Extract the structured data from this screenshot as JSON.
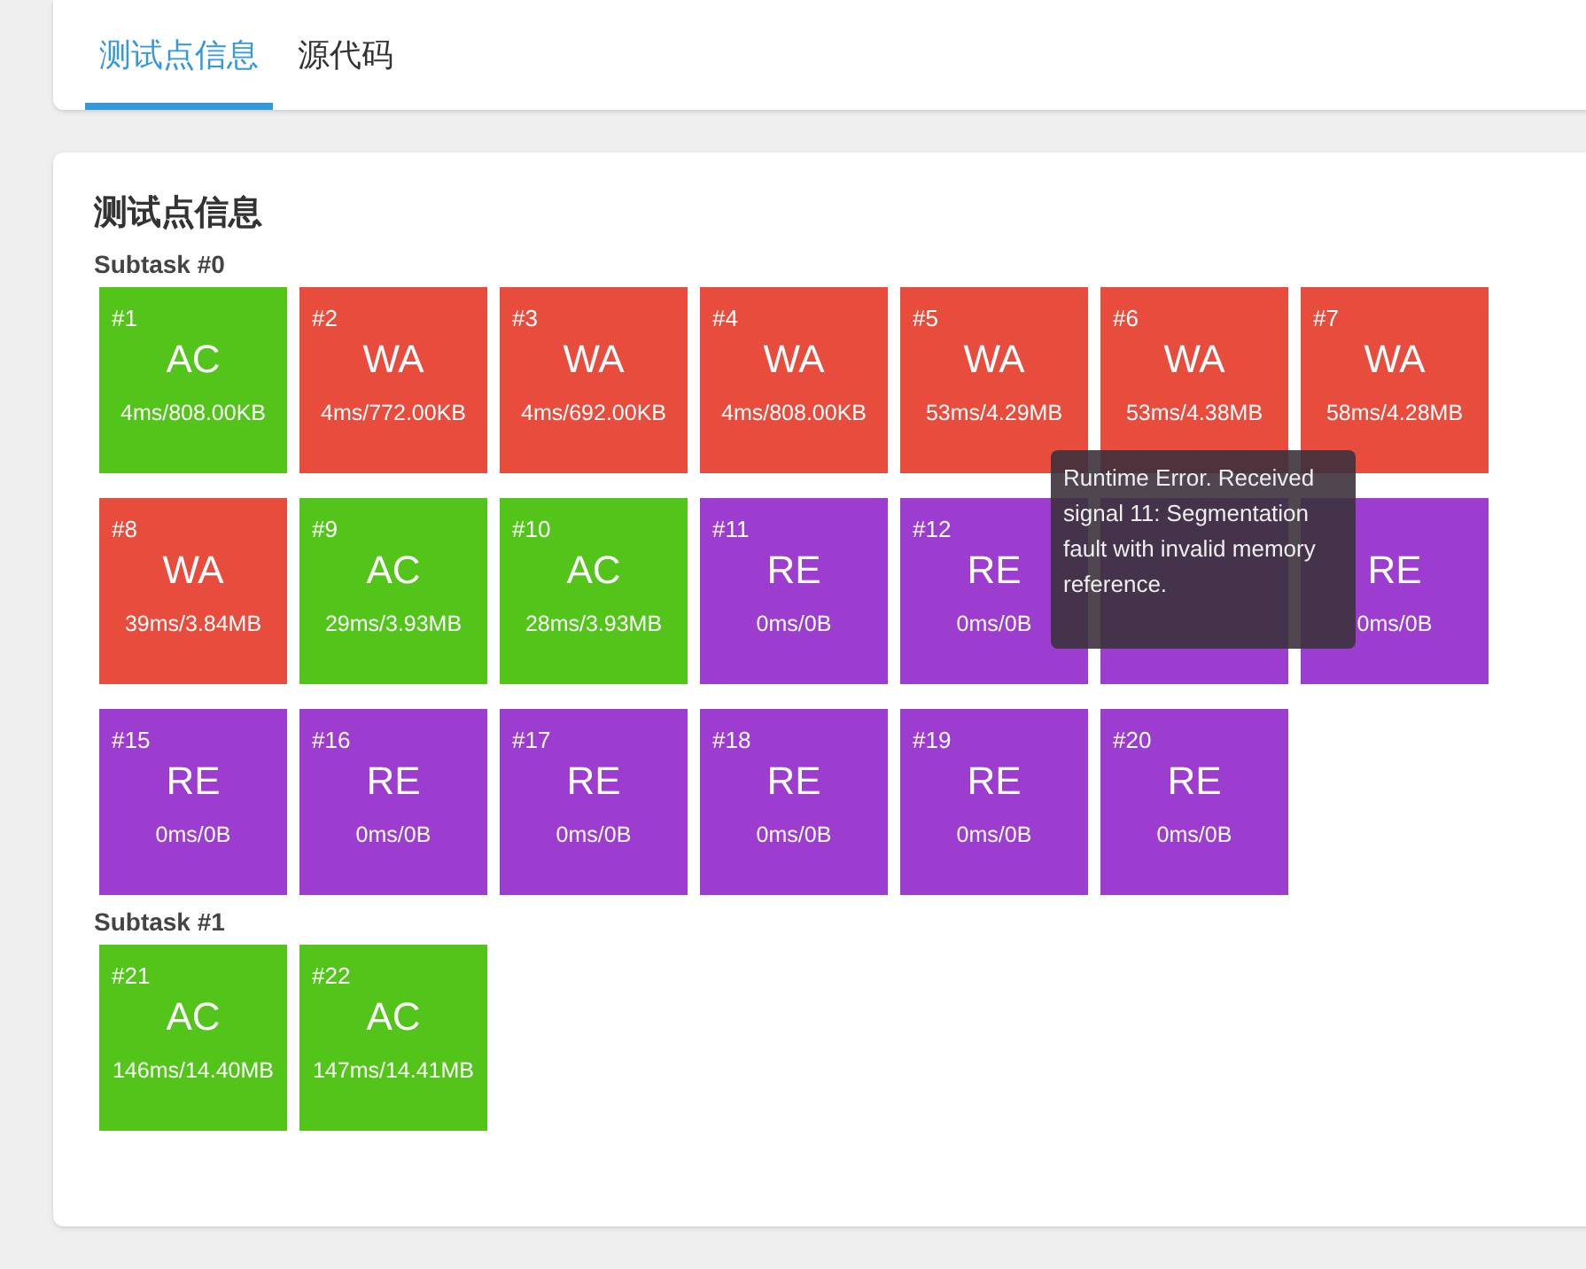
{
  "tabs": [
    {
      "label": "测试点信息",
      "selected": true
    },
    {
      "label": "源代码",
      "selected": false
    }
  ],
  "title": "测试点信息",
  "subtasks": [
    {
      "label": "Subtask #0",
      "cases": [
        {
          "id": "#1",
          "status": "AC",
          "usage": "4ms/808.00KB",
          "color": "#52c41a"
        },
        {
          "id": "#2",
          "status": "WA",
          "usage": "4ms/772.00KB",
          "color": "#e74c3c"
        },
        {
          "id": "#3",
          "status": "WA",
          "usage": "4ms/692.00KB",
          "color": "#e74c3c"
        },
        {
          "id": "#4",
          "status": "WA",
          "usage": "4ms/808.00KB",
          "color": "#e74c3c"
        },
        {
          "id": "#5",
          "status": "WA",
          "usage": "53ms/4.29MB",
          "color": "#e74c3c"
        },
        {
          "id": "#6",
          "status": "WA",
          "usage": "53ms/4.38MB",
          "color": "#e74c3c"
        },
        {
          "id": "#7",
          "status": "WA",
          "usage": "58ms/4.28MB",
          "color": "#e74c3c"
        },
        {
          "id": "#8",
          "status": "WA",
          "usage": "39ms/3.84MB",
          "color": "#e74c3c"
        },
        {
          "id": "#9",
          "status": "AC",
          "usage": "29ms/3.93MB",
          "color": "#52c41a"
        },
        {
          "id": "#10",
          "status": "AC",
          "usage": "28ms/3.93MB",
          "color": "#52c41a"
        },
        {
          "id": "#11",
          "status": "RE",
          "usage": "0ms/0B",
          "color": "#9d3dcf"
        },
        {
          "id": "#12",
          "status": "RE",
          "usage": "0ms/0B",
          "color": "#9d3dcf"
        },
        {
          "color": "#9d3dcf"
        },
        {
          "status": "RE",
          "usage": "0ms/0B",
          "color": "#9d3dcf"
        },
        {
          "id": "#15",
          "status": "RE",
          "usage": "0ms/0B",
          "color": "#9d3dcf"
        },
        {
          "id": "#16",
          "status": "RE",
          "usage": "0ms/0B",
          "color": "#9d3dcf"
        },
        {
          "id": "#17",
          "status": "RE",
          "usage": "0ms/0B",
          "color": "#9d3dcf"
        },
        {
          "id": "#18",
          "status": "RE",
          "usage": "0ms/0B",
          "color": "#9d3dcf"
        },
        {
          "id": "#19",
          "status": "RE",
          "usage": "0ms/0B",
          "color": "#9d3dcf"
        },
        {
          "id": "#20",
          "status": "RE",
          "usage": "0ms/0B",
          "color": "#9d3dcf"
        }
      ]
    },
    {
      "label": "Subtask #1",
      "cases": [
        {
          "id": "#21",
          "status": "AC",
          "usage": "146ms/14.40MB",
          "color": "#52c41a"
        },
        {
          "id": "#22",
          "status": "AC",
          "usage": "147ms/14.41MB",
          "color": "#52c41a"
        }
      ]
    }
  ],
  "tooltip": {
    "text": "Runtime Error. Received signal 11: Segmentation fault with invalid memory reference."
  }
}
